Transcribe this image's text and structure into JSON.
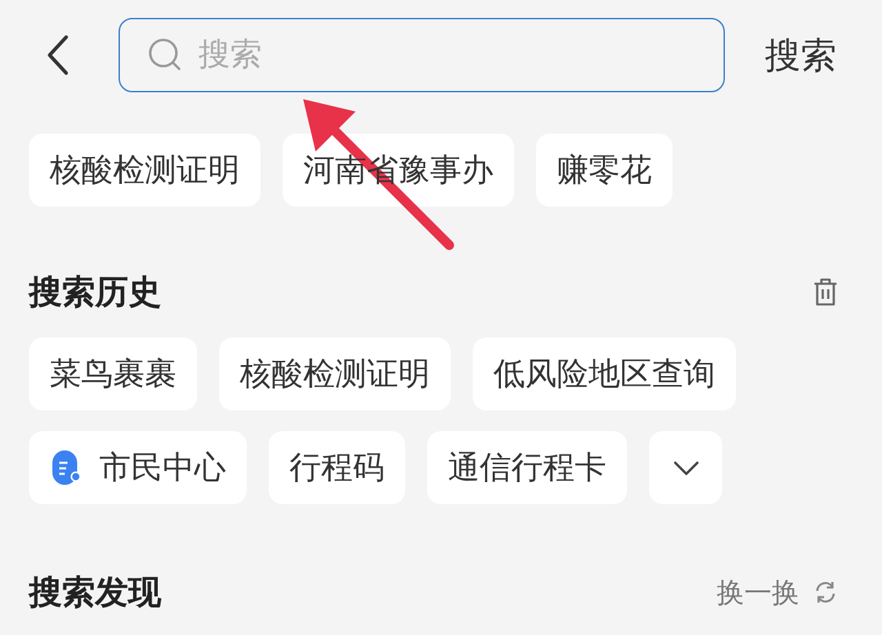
{
  "search": {
    "placeholder": "搜索",
    "button": "搜索"
  },
  "suggestions": [
    "核酸检测证明",
    "河南省豫事办",
    "赚零花"
  ],
  "history": {
    "title": "搜索历史",
    "items": [
      {
        "kind": "text",
        "label": "菜鸟裹裹"
      },
      {
        "kind": "text",
        "label": "核酸检测证明"
      },
      {
        "kind": "text",
        "label": "低风险地区查询"
      },
      {
        "kind": "app",
        "label": "市民中心"
      },
      {
        "kind": "text",
        "label": "行程码"
      },
      {
        "kind": "text",
        "label": "通信行程卡"
      }
    ],
    "expanded": false
  },
  "discover": {
    "title": "搜索发现",
    "refresh": "换一换"
  }
}
